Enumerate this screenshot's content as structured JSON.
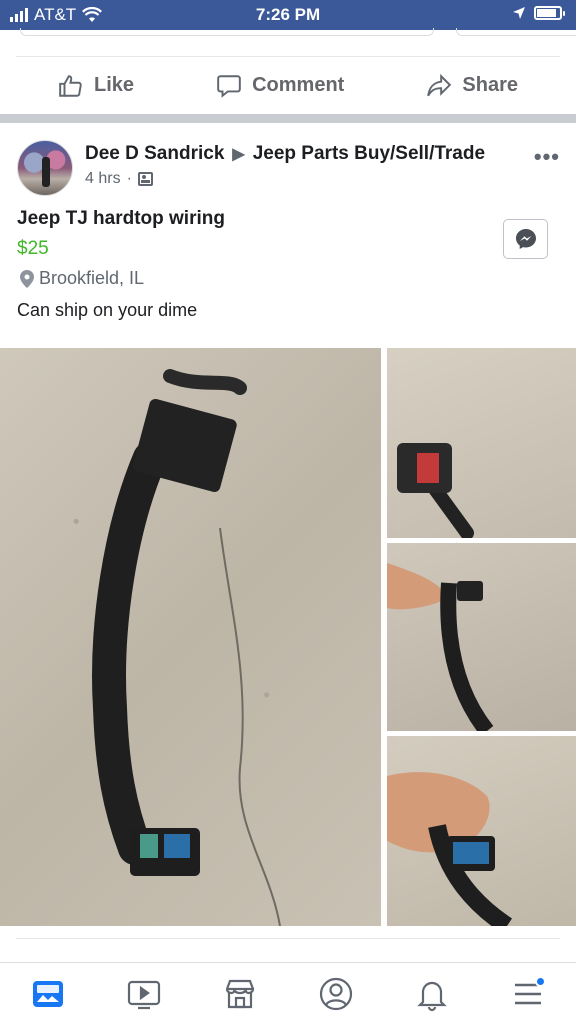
{
  "status_bar": {
    "carrier": "AT&T",
    "time": "7:26 PM",
    "colors": {
      "background": "#3b5998"
    }
  },
  "action_bar": {
    "like_label": "Like",
    "comment_label": "Comment",
    "share_label": "Share"
  },
  "post": {
    "author": "Dee D Sandrick",
    "group": "Jeep Parts Buy/Sell/Trade",
    "time_ago": "4 hrs",
    "meta_separator": "·",
    "listing": {
      "title": "Jeep TJ hardtop wiring",
      "price": "$25",
      "location": "Brookfield, IL",
      "description": "Can ship on your dime"
    },
    "colors": {
      "price": "#42b72a",
      "accent": "#1877f2"
    }
  },
  "icons": {
    "like": "thumbs-up-icon",
    "comment": "comment-icon",
    "share": "share-icon",
    "messenger": "messenger-icon",
    "location": "location-pin-icon",
    "group_privacy": "group-icon",
    "more": "more-icon"
  },
  "bottom_nav": [
    {
      "name": "news-feed",
      "icon": "news-feed-icon",
      "active": true
    },
    {
      "name": "watch",
      "icon": "watch-icon",
      "active": false
    },
    {
      "name": "marketplace",
      "icon": "marketplace-icon",
      "active": false
    },
    {
      "name": "profile",
      "icon": "profile-icon",
      "active": false
    },
    {
      "name": "notifications",
      "icon": "bell-icon",
      "active": false
    },
    {
      "name": "menu",
      "icon": "menu-icon",
      "active": false,
      "badge": true
    }
  ]
}
